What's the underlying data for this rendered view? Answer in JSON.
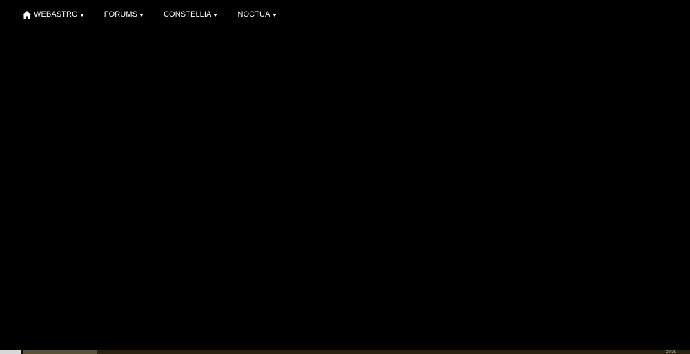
{
  "nav": {
    "items": [
      {
        "label": "WEBASTRO",
        "icon": "home-icon"
      },
      {
        "label": "FORUMS"
      },
      {
        "label": "CONSTELLIA"
      },
      {
        "label": "NOCTUA"
      }
    ]
  },
  "taskbar": {
    "clock": "20:50"
  },
  "colors": {
    "background": "#000000",
    "nav_text": "#ffffff",
    "taskbar": "#2a2410"
  }
}
